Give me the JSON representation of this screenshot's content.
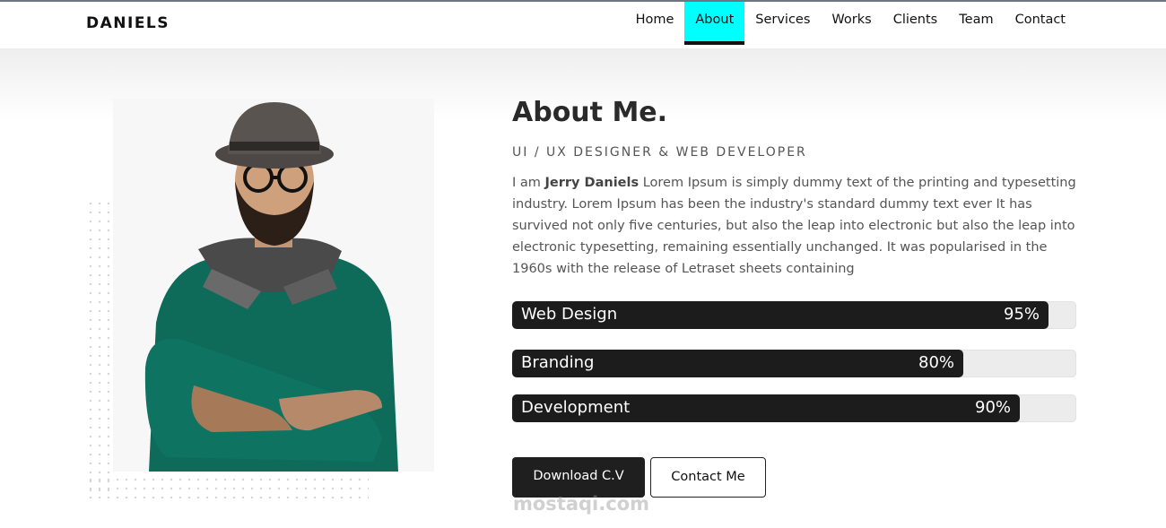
{
  "brand": {
    "logo": "DANIELS"
  },
  "nav": {
    "items": [
      {
        "label": "Home",
        "active": false
      },
      {
        "label": "About",
        "active": true
      },
      {
        "label": "Services",
        "active": false
      },
      {
        "label": "Works",
        "active": false
      },
      {
        "label": "Clients",
        "active": false
      },
      {
        "label": "Team",
        "active": false
      },
      {
        "label": "Contact",
        "active": false
      }
    ]
  },
  "about": {
    "title": "About Me.",
    "subtitle": "UI / UX DESIGNER & WEB DEVELOPER",
    "intro_prefix": "I am ",
    "name": "Jerry Daniels",
    "intro_body": " Lorem Ipsum is simply dummy text of the printing and typesetting industry. Lorem Ipsum has been the industry's standard dummy text ever It has survived not only five centuries, but also the leap into electronic but also the leap into electronic typesetting, remaining essentially unchanged. It was popularised in the 1960s with the release of Letraset sheets containing"
  },
  "skills": [
    {
      "label": "Web Design",
      "percent_text": "95%",
      "level": 0.95
    },
    {
      "label": "Branding",
      "percent_text": "80%",
      "level": 0.8
    },
    {
      "label": "Development",
      "percent_text": "90%",
      "level": 0.9
    }
  ],
  "buttons": {
    "download": "Download C.V",
    "contact": "Contact Me"
  },
  "watermark": "mostaqi.com",
  "colors": {
    "accent": "#00ffff",
    "dark": "#1c1c1c",
    "track": "#ececec"
  }
}
